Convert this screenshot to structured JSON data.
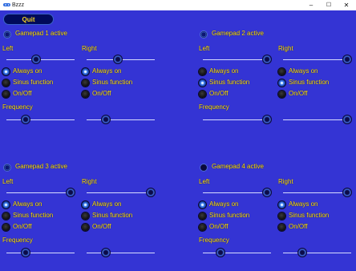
{
  "window": {
    "title": "Bzzz",
    "minimize": "–",
    "maximize": "☐",
    "close": "✕"
  },
  "toolbar": {
    "quit_label": "Quit"
  },
  "labels": {
    "left": "Left",
    "right": "Right",
    "always_on": "Always on",
    "sinus": "Sinus function",
    "onoff": "On/Off",
    "frequency": "Frequency"
  },
  "gamepads": [
    {
      "title": "Gamepad 1 active",
      "active": true,
      "left": {
        "level": 0.42,
        "mode": "always_on"
      },
      "right": {
        "level": 0.45,
        "mode": "always_on"
      },
      "frequency": {
        "left": 0.25,
        "right": 0.25
      }
    },
    {
      "title": "Gamepad 2 active",
      "active": true,
      "left": {
        "level": 1.0,
        "mode": "sinus"
      },
      "right": {
        "level": 1.0,
        "mode": "sinus"
      },
      "frequency": {
        "left": 1.0,
        "right": 1.0
      }
    },
    {
      "title": "Gamepad 3 active",
      "active": true,
      "left": {
        "level": 1.0,
        "mode": "always_on"
      },
      "right": {
        "level": 1.0,
        "mode": "always_on"
      },
      "frequency": {
        "left": 0.25,
        "right": 0.25
      }
    },
    {
      "title": "Gamepad 4 active",
      "active": false,
      "left": {
        "level": 1.0,
        "mode": "always_on"
      },
      "right": {
        "level": 1.0,
        "mode": "always_on"
      },
      "frequency": {
        "left": 0.22,
        "right": 0.25
      }
    }
  ],
  "colors": {
    "background": "#3434d4",
    "text": "#ffe014",
    "quit_bg": "#000a5a"
  }
}
